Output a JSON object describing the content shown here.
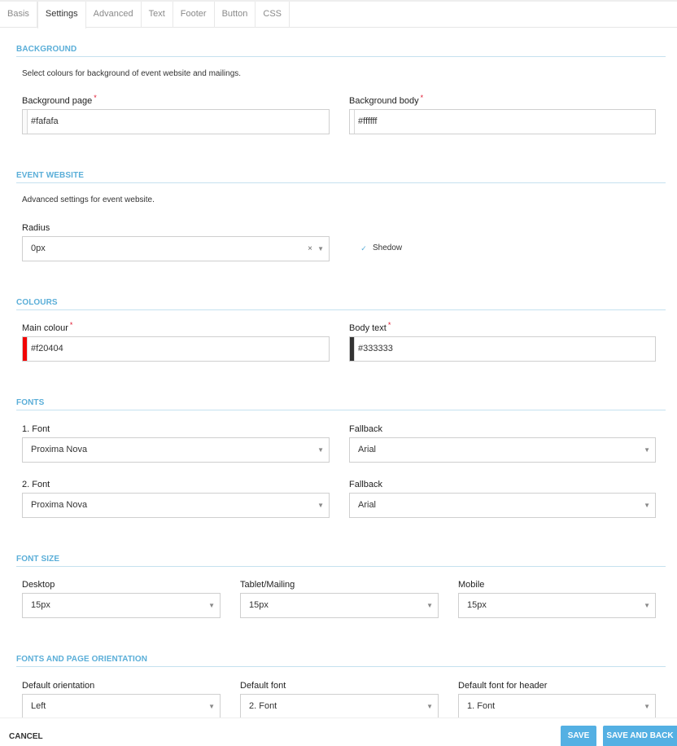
{
  "tabs": [
    "Basis",
    "Settings",
    "Advanced",
    "Text",
    "Footer",
    "Button",
    "CSS"
  ],
  "sections": {
    "background": {
      "title": "BACKGROUND",
      "description": "Select colours for background of event website and mailings.",
      "page_label": "Background page",
      "page_value": "#fafafa",
      "page_swatch": "#fafafa",
      "body_label": "Background body",
      "body_value": "#ffffff",
      "body_swatch": "#ffffff"
    },
    "event_website": {
      "title": "EVENT WEBSITE",
      "description": "Advanced settings for event website.",
      "radius_label": "Radius",
      "radius_value": "0px",
      "clear_icon": "×",
      "shadow_label": "Shedow",
      "shadow_checked": true
    },
    "colours": {
      "title": "COLOURS",
      "main_label": "Main colour",
      "main_value": "#f20404",
      "main_swatch": "#f20404",
      "body_label": "Body text",
      "body_value": "#333333",
      "body_swatch": "#333333"
    },
    "fonts": {
      "title": "FONTS",
      "font1_label": "1. Font",
      "font1_value": "Proxima Nova",
      "fallback1_label": "Fallback",
      "fallback1_value": "Arial",
      "font2_label": "2. Font",
      "font2_value": "Proxima Nova",
      "fallback2_label": "Fallback",
      "fallback2_value": "Arial"
    },
    "font_size": {
      "title": "FONT SIZE",
      "desktop_label": "Desktop",
      "desktop_value": "15px",
      "tablet_label": "Tablet/Mailing",
      "tablet_value": "15px",
      "mobile_label": "Mobile",
      "mobile_value": "15px"
    },
    "orientation": {
      "title": "FONTS AND PAGE ORIENTATION",
      "default_orientation_label": "Default orientation",
      "default_orientation_value": "Left",
      "default_font_label": "Default font",
      "default_font_value": "2. Font",
      "header_font_label": "Default font for header",
      "header_font_value": "1. Font"
    }
  },
  "required_mark": "*",
  "dropdown_arrow": "▼",
  "checkmark": "✓",
  "footer": {
    "cancel": "CANCEL",
    "save": "SAVE",
    "save_and_back": "SAVE AND BACK"
  },
  "colors": {
    "accent": "#54b0e3",
    "required": "#e0152d"
  }
}
